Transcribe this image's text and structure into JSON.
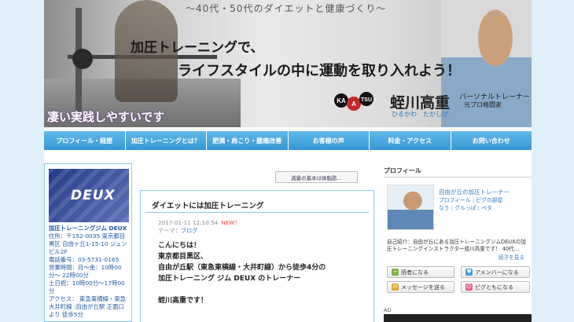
{
  "header": {
    "slogan": "～40代・50代のダイエットと健康づくり～",
    "headline1": "加圧トレーニングで、",
    "headline2": "ライフスタイルの中に運動を取り入れよう！",
    "subline": "凄い実践しやすいです",
    "logo_text": "KAATSU TRAINING",
    "trainer_name": "蛭川高重",
    "trainer_kana": "ひるかわ　たかしげ",
    "trainer_title1": "パーソナルトレーナー",
    "trainer_title2": "元プロ格闘家"
  },
  "nav": {
    "items": [
      {
        "label": "プロフィール・経歴"
      },
      {
        "label": "加圧トレーニングとは？"
      },
      {
        "label": "肥満・肩こり・腰痛改善"
      },
      {
        "label": "お客様の声"
      },
      {
        "label": "料金・アクセス"
      },
      {
        "label": "お問い合わせ"
      }
    ]
  },
  "left": {
    "logo_word": "DEUX",
    "gym_name": "加圧トレーニングジム DEUX",
    "address": "住所：〒152-0035 東京都目黒区 自由ヶ丘1-15-10 ジュンビル2F",
    "phone": "電話番号：03-5731-0165",
    "hours": "営業時間：月〜金：10時00分〜 22時00分",
    "saturday": "土日祝：10時00分〜17時00分",
    "access": "アクセス： 東急東横線・東急大井町線 :自由が丘駅 正面口より 徒歩5分"
  },
  "main": {
    "prev_link": "減量の基本は体脂肪…",
    "post_title": "ダイエットには加圧トレーニング",
    "post_date": "2017-01-11 12:10:54",
    "new_badge": "NEW！",
    "theme_label": "テーマ：",
    "theme_link": "ブログ",
    "body": [
      "こんにちは！",
      "東京都目黒区、",
      "自由が丘駅（東急東横線・大井町線）から徒歩4分の",
      "加圧トレーニング ジム DEUX のトレーナー",
      "",
      "蛭川高重です！"
    ]
  },
  "right": {
    "heading": "プロフィール",
    "profile_name": "自由が丘の加圧トレーナー",
    "links": [
      "プロフィール",
      "ピグの部屋",
      "なう",
      "グルっぽ",
      "ペタ"
    ],
    "intro": "自己紹介：自由が丘にある加圧トレーニングジムDEUXの加圧トレーニングインストラクター蛭川高重です！ 40代…",
    "more": "続きを見る",
    "buttons": [
      {
        "label": "読者になる",
        "icon": "reader-icon",
        "color": "#7cb342"
      },
      {
        "label": "アメンバーになる",
        "icon": "amember-icon",
        "color": "#43a0d8"
      },
      {
        "label": "メッセージを送る",
        "icon": "message-icon",
        "color": "#e4a326"
      },
      {
        "label": "ピグともになる",
        "icon": "pigg-icon",
        "color": "#e05d8a"
      }
    ],
    "ad_label": "AD"
  },
  "colors": {
    "page_bg": "#dff0fb",
    "nav_blue": "#3597d3",
    "link_blue": "#2b7bbf",
    "border_blue": "#8ac9ee",
    "new_red": "#e54545"
  }
}
